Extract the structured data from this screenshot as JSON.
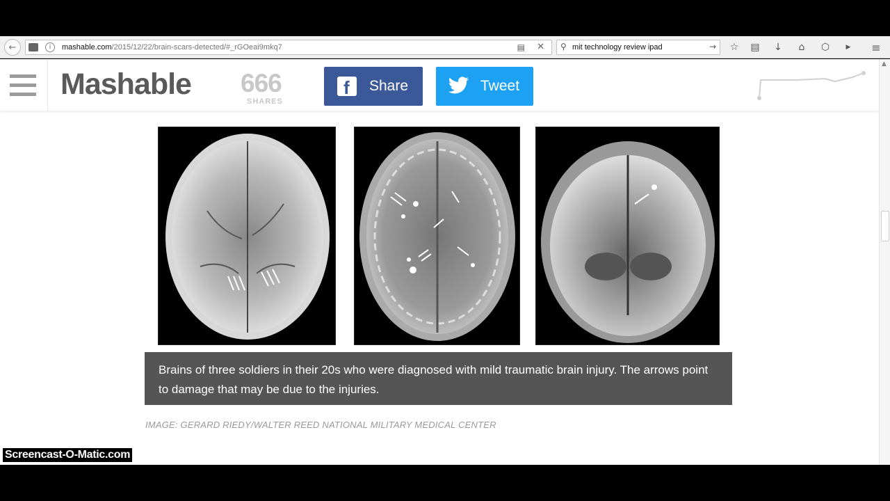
{
  "browser": {
    "url_host": "mashable.com",
    "url_path": "/2015/12/22/brain-scars-detected/#_rGOeai9mkq7",
    "search_query": "mit technology review ipad",
    "icons": [
      "back-icon",
      "site-icon",
      "info-icon",
      "reader-view-icon",
      "stop-icon",
      "search-icon",
      "search-go-icon",
      "bookmark-star-icon",
      "library-icon",
      "download-icon",
      "home-icon",
      "pocket-icon",
      "youtube-icon",
      "menu-icon"
    ]
  },
  "header": {
    "logo": "Mashable",
    "shares_count": "666",
    "shares_label": "SHARES",
    "share_label": "Share",
    "tweet_label": "Tweet",
    "facebook_color": "#3b5998",
    "twitter_color": "#1da1f2"
  },
  "article": {
    "images": [
      "mri-scan-1",
      "mri-scan-2",
      "mri-scan-3"
    ],
    "caption": "Brains of three soldiers in their 20s who were diagnosed with mild traumatic brain injury. The arrows point to damage that may be due to the injuries.",
    "credit": "IMAGE: GERARD RIEDY/WALTER REED NATIONAL MILITARY MEDICAL CENTER"
  },
  "overlay": {
    "watermark": "Screencast-O-Matic.com"
  }
}
